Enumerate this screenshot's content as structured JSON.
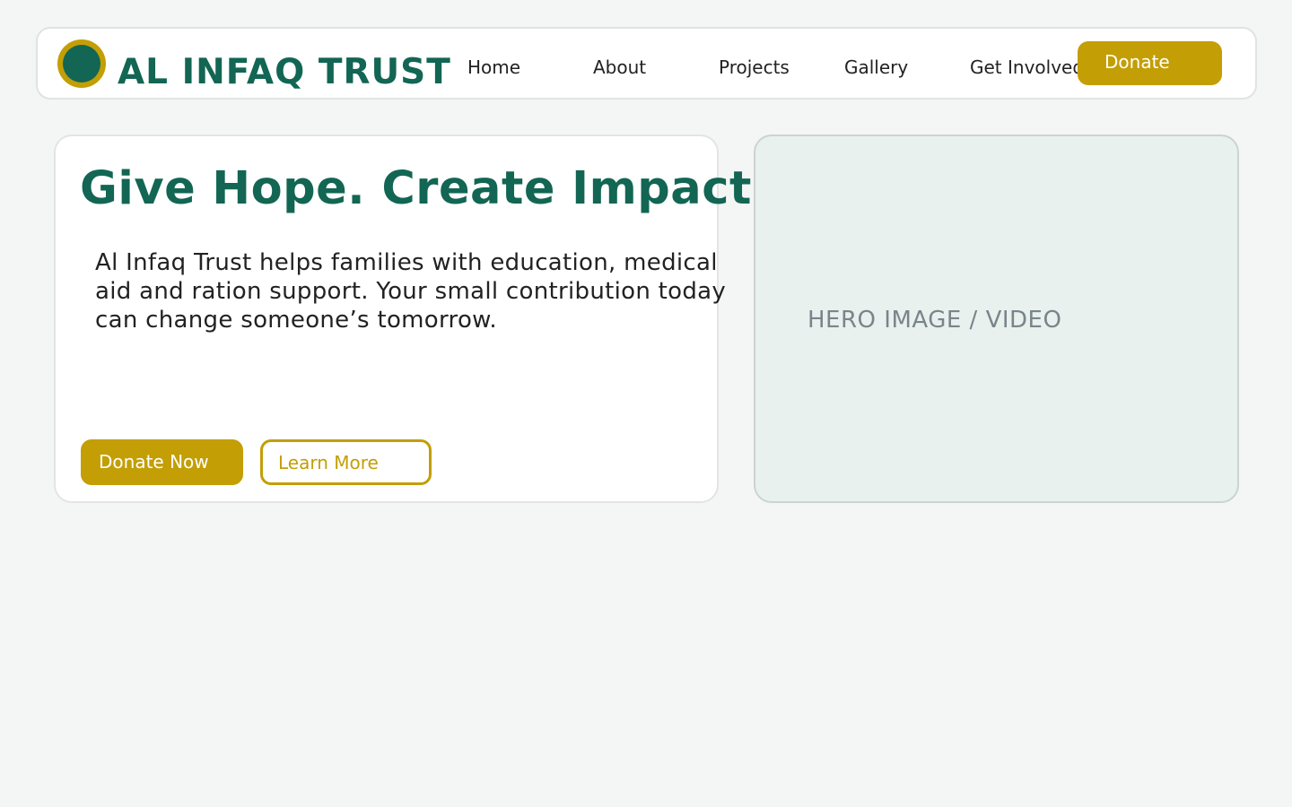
{
  "header": {
    "brand": "AL INFAQ TRUST",
    "logo_icon": "circle-emblem-icon",
    "nav": [
      {
        "label": "Home"
      },
      {
        "label": "About"
      },
      {
        "label": "Projects"
      },
      {
        "label": "Gallery"
      },
      {
        "label": "Get Involved"
      }
    ],
    "donate_label": "Donate"
  },
  "hero": {
    "title": "Give Hope. Create Impact.",
    "lines": [
      "Al Infaq Trust helps families with education, medical",
      "aid and ration support. Your small contribution today",
      "can change someone’s tomorrow."
    ],
    "primary_label": "Donate Now",
    "secondary_label": "Learn More",
    "media_placeholder": "HERO IMAGE / VIDEO"
  },
  "colors": {
    "brand_green": "#126653",
    "gold": "#c39e05",
    "background": "#f4f6f5",
    "media_background": "#e8f1ee"
  }
}
